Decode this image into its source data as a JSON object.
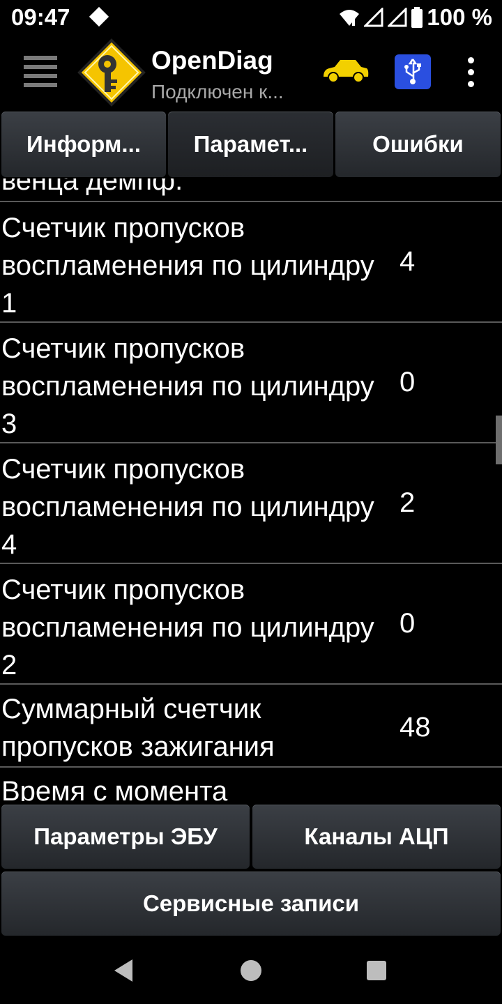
{
  "status_bar": {
    "time": "09:47",
    "battery_text": "100 %",
    "icons": [
      "notification-diamond-icon",
      "wifi-icon",
      "signal-icon",
      "signal-icon",
      "battery-icon"
    ]
  },
  "app_bar": {
    "title": "OpenDiag",
    "subtitle": "Подключен к...",
    "icons": [
      "menu-icon",
      "app-logo-icon",
      "car-icon",
      "usb-icon",
      "overflow-menu-icon"
    ],
    "colors": {
      "car": "#f2d000",
      "usb_bg": "#2a4fe0",
      "logo": "#f5c400"
    }
  },
  "tabs": [
    {
      "label": "Информ..."
    },
    {
      "label": "Парамет..."
    },
    {
      "label": "Ошибки"
    }
  ],
  "params": {
    "partial_top": "венца демпф.",
    "rows": [
      {
        "name": "Счетчик пропусков воспламенения по цилиндру 1",
        "value": "4"
      },
      {
        "name": "Счетчик пропусков воспламенения по цилиндру 3",
        "value": "0"
      },
      {
        "name": "Счетчик пропусков воспламенения по цилиндру 4",
        "value": "2"
      },
      {
        "name": "Счетчик пропусков воспламенения по цилиндру 2",
        "value": "0"
      },
      {
        "name": "Суммарный счетчик пропусков зажигания",
        "value": "48"
      }
    ],
    "partial_bottom": "Время с момента"
  },
  "buttons": {
    "ecu_params": "Параметры ЭБУ",
    "adc_channels": "Каналы АЦП",
    "service_records": "Сервисные записи"
  },
  "nav_bar": {
    "icons": [
      "back-icon",
      "home-icon",
      "recent-apps-icon"
    ]
  }
}
